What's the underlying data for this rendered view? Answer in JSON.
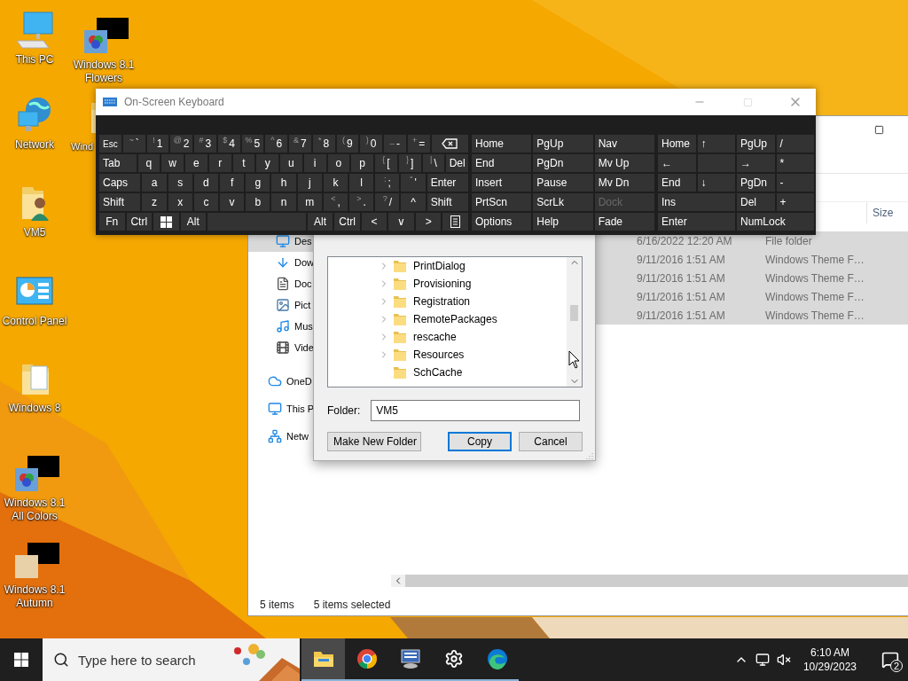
{
  "desktop_icons": [
    {
      "label": "This PC"
    },
    {
      "label": "Windows 8.1 Flowers"
    },
    {
      "label": "Network"
    },
    {
      "label": "Wind"
    },
    {
      "label": "VM5"
    },
    {
      "label": "Control Panel"
    },
    {
      "label": "Windows 8"
    },
    {
      "label": "Windows 8.1 All Colors"
    },
    {
      "label": "Windows 8.1 Autumn"
    }
  ],
  "explorer": {
    "column_header": "Size",
    "nav_items": [
      {
        "label": "Des",
        "kind": "child",
        "selected": true
      },
      {
        "label": "Dow",
        "kind": "child",
        "selected": false
      },
      {
        "label": "Doc",
        "kind": "child",
        "selected": false
      },
      {
        "label": "Pict",
        "kind": "child",
        "selected": false
      },
      {
        "label": "Mus",
        "kind": "child",
        "selected": false
      },
      {
        "label": "Vide",
        "kind": "child",
        "selected": false
      },
      {
        "label": "OneD",
        "kind": "root",
        "selected": false
      },
      {
        "label": "This P",
        "kind": "root",
        "selected": false
      },
      {
        "label": "Netw",
        "kind": "root",
        "selected": false
      }
    ],
    "rows": [
      {
        "date": "6/16/2022 12:20 AM",
        "type": "File folder",
        "selected": true
      },
      {
        "date": "9/11/2016 1:51 AM",
        "type": "Windows Theme F…",
        "selected": true
      },
      {
        "date": "9/11/2016 1:51 AM",
        "type": "Windows Theme F…",
        "selected": true
      },
      {
        "date": "9/11/2016 1:51 AM",
        "type": "Windows Theme F…",
        "selected": true
      },
      {
        "date": "9/11/2016 1:51 AM",
        "type": "Windows Theme F…",
        "selected": true
      }
    ],
    "status": {
      "count": "5 items",
      "selection": "5 items selected"
    }
  },
  "dialog": {
    "tree": [
      {
        "label": "PrintDialog",
        "expandable": true
      },
      {
        "label": "Provisioning",
        "expandable": true
      },
      {
        "label": "Registration",
        "expandable": true
      },
      {
        "label": "RemotePackages",
        "expandable": true
      },
      {
        "label": "rescache",
        "expandable": true
      },
      {
        "label": "Resources",
        "expandable": true
      },
      {
        "label": "SchCache",
        "expandable": false
      }
    ],
    "folder_label": "Folder:",
    "folder_value": "VM5",
    "buttons": [
      {
        "label": "Make New Folder",
        "default": false
      },
      {
        "label": "Copy",
        "default": true
      },
      {
        "label": "Cancel",
        "default": false
      }
    ]
  },
  "keyboard": {
    "title": "On-Screen Keyboard",
    "main_rows": [
      [
        {
          "kind": "small",
          "label": "Esc"
        },
        {
          "kind": "key",
          "label": "`",
          "shift": "~"
        },
        {
          "kind": "key",
          "label": "1",
          "shift": "!"
        },
        {
          "kind": "key",
          "label": "2",
          "shift": "@"
        },
        {
          "kind": "key",
          "label": "3",
          "shift": "#"
        },
        {
          "kind": "key",
          "label": "4",
          "shift": "$"
        },
        {
          "kind": "key",
          "label": "5",
          "shift": "%"
        },
        {
          "kind": "key",
          "label": "6",
          "shift": "^"
        },
        {
          "kind": "key",
          "label": "7",
          "shift": "&"
        },
        {
          "kind": "key",
          "label": "8",
          "shift": "*"
        },
        {
          "kind": "key",
          "label": "9",
          "shift": "("
        },
        {
          "kind": "key",
          "label": "0",
          "shift": ")"
        },
        {
          "kind": "key",
          "label": "-",
          "shift": "_"
        },
        {
          "kind": "key",
          "label": "=",
          "shift": "+"
        },
        {
          "kind": "backspace"
        }
      ],
      [
        {
          "kind": "mod",
          "label": "Tab"
        },
        {
          "kind": "key",
          "label": "q"
        },
        {
          "kind": "key",
          "label": "w"
        },
        {
          "kind": "key",
          "label": "e"
        },
        {
          "kind": "key",
          "label": "r"
        },
        {
          "kind": "key",
          "label": "t"
        },
        {
          "kind": "key",
          "label": "y"
        },
        {
          "kind": "key",
          "label": "u"
        },
        {
          "kind": "key",
          "label": "i"
        },
        {
          "kind": "key",
          "label": "o"
        },
        {
          "kind": "key",
          "label": "p"
        },
        {
          "kind": "key",
          "label": "[",
          "shift": "{"
        },
        {
          "kind": "key",
          "label": "]",
          "shift": "}"
        },
        {
          "kind": "key",
          "label": "\\",
          "shift": "|"
        },
        {
          "kind": "key",
          "label": "Del"
        }
      ],
      [
        {
          "kind": "mod",
          "label": "Caps"
        },
        {
          "kind": "key",
          "label": "a"
        },
        {
          "kind": "key",
          "label": "s"
        },
        {
          "kind": "key",
          "label": "d"
        },
        {
          "kind": "key",
          "label": "f"
        },
        {
          "kind": "key",
          "label": "g"
        },
        {
          "kind": "key",
          "label": "h"
        },
        {
          "kind": "key",
          "label": "j"
        },
        {
          "kind": "key",
          "label": "k"
        },
        {
          "kind": "key",
          "label": "l"
        },
        {
          "kind": "key",
          "label": ";",
          "shift": ":"
        },
        {
          "kind": "key",
          "label": "'",
          "shift": "\""
        },
        {
          "kind": "mod",
          "label": "Enter"
        }
      ],
      [
        {
          "kind": "mod",
          "label": "Shift"
        },
        {
          "kind": "key",
          "label": "z"
        },
        {
          "kind": "key",
          "label": "x"
        },
        {
          "kind": "key",
          "label": "c"
        },
        {
          "kind": "key",
          "label": "v"
        },
        {
          "kind": "key",
          "label": "b"
        },
        {
          "kind": "key",
          "label": "n"
        },
        {
          "kind": "key",
          "label": "m"
        },
        {
          "kind": "key",
          "label": ",",
          "shift": "<"
        },
        {
          "kind": "key",
          "label": ".",
          "shift": ">"
        },
        {
          "kind": "key",
          "label": "/",
          "shift": "?"
        },
        {
          "kind": "key",
          "label": "^"
        },
        {
          "kind": "mod",
          "label": "Shift"
        }
      ],
      [
        {
          "kind": "key",
          "label": "Fn"
        },
        {
          "kind": "key",
          "label": "Ctrl"
        },
        {
          "kind": "windows"
        },
        {
          "kind": "key",
          "label": "Alt"
        },
        {
          "kind": "space"
        },
        {
          "kind": "key",
          "label": "Alt"
        },
        {
          "kind": "key",
          "label": "Ctrl"
        },
        {
          "kind": "key",
          "label": "<"
        },
        {
          "kind": "key",
          "label": "∨"
        },
        {
          "kind": "key",
          "label": ">"
        },
        {
          "kind": "menu"
        }
      ]
    ],
    "nav_keys": [
      {
        "label": "Home",
        "disabled": false
      },
      {
        "label": "PgUp",
        "disabled": false
      },
      {
        "label": "Nav",
        "disabled": false
      },
      {
        "label": "End",
        "disabled": false
      },
      {
        "label": "PgDn",
        "disabled": false
      },
      {
        "label": "Mv Up",
        "disabled": false
      },
      {
        "label": "Insert",
        "disabled": false
      },
      {
        "label": "Pause",
        "disabled": false
      },
      {
        "label": "Mv Dn",
        "disabled": false
      },
      {
        "label": "PrtScn",
        "disabled": false
      },
      {
        "label": "ScrLk",
        "disabled": false
      },
      {
        "label": "Dock",
        "disabled": true
      },
      {
        "label": "Options",
        "disabled": false
      },
      {
        "label": "Help",
        "disabled": false
      },
      {
        "label": "Fade",
        "disabled": false
      }
    ],
    "numpad_rows": [
      [
        {
          "kind": "key",
          "label": "Home"
        },
        {
          "kind": "key",
          "label": "↑"
        },
        {
          "kind": "key",
          "label": "PgUp"
        },
        {
          "kind": "key",
          "label": "/"
        }
      ],
      [
        {
          "kind": "key",
          "label": "←"
        },
        {
          "kind": "blank"
        },
        {
          "kind": "key",
          "label": "→"
        },
        {
          "kind": "key",
          "label": "*"
        }
      ],
      [
        {
          "kind": "key",
          "label": "End"
        },
        {
          "kind": "key",
          "label": "↓"
        },
        {
          "kind": "key",
          "label": "PgDn"
        },
        {
          "kind": "key",
          "label": "-"
        }
      ],
      [
        {
          "kind": "wide",
          "label": "Ins"
        },
        {
          "kind": "key",
          "label": "Del"
        },
        {
          "kind": "key",
          "label": "+"
        }
      ],
      [
        {
          "kind": "wide",
          "label": "Enter"
        },
        {
          "kind": "wide",
          "label": "NumLock"
        }
      ]
    ]
  },
  "taskbar": {
    "search_placeholder": "Type here to search",
    "apps": [
      {
        "active": true
      },
      {
        "active": false
      },
      {
        "active": false
      },
      {
        "active": false
      },
      {
        "active": false
      }
    ],
    "time": "6:10 AM",
    "date": "10/29/2023",
    "notifications": "2"
  }
}
